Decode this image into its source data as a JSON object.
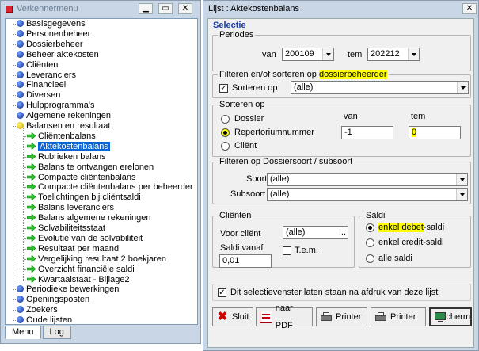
{
  "menu_window": {
    "title": "Verkennermenu",
    "tree": [
      {
        "label": "Basisgegevens",
        "level": 0,
        "kind": "node"
      },
      {
        "label": "Personenbeheer",
        "level": 0,
        "kind": "node"
      },
      {
        "label": "Dossierbeheer",
        "level": 0,
        "kind": "node"
      },
      {
        "label": "Beheer aktekosten",
        "level": 0,
        "kind": "node"
      },
      {
        "label": "Cliënten",
        "level": 0,
        "kind": "node"
      },
      {
        "label": "Leveranciers",
        "level": 0,
        "kind": "node"
      },
      {
        "label": "Financieel",
        "level": 0,
        "kind": "node"
      },
      {
        "label": "Diversen",
        "level": 0,
        "kind": "node"
      },
      {
        "label": "Hulpprogramma's",
        "level": 0,
        "kind": "node"
      },
      {
        "label": "Algemene rekeningen",
        "level": 0,
        "kind": "node"
      },
      {
        "label": "Balansen en resultaat",
        "level": 0,
        "kind": "open"
      },
      {
        "label": "Cliëntenbalans",
        "level": 1,
        "kind": "leaf"
      },
      {
        "label": "Aktekostenbalans",
        "level": 1,
        "kind": "leaf",
        "selected": true
      },
      {
        "label": "Rubrieken balans",
        "level": 1,
        "kind": "leaf"
      },
      {
        "label": "Balans te ontvangen erelonen",
        "level": 1,
        "kind": "leaf"
      },
      {
        "label": "Compacte cliëntenbalans",
        "level": 1,
        "kind": "leaf"
      },
      {
        "label": "Compacte cliëntenbalans per beheerder",
        "level": 1,
        "kind": "leaf"
      },
      {
        "label": "Toelichtingen bij cliëntsaldi",
        "level": 1,
        "kind": "leaf"
      },
      {
        "label": "Balans leveranciers",
        "level": 1,
        "kind": "leaf"
      },
      {
        "label": "Balans algemene rekeningen",
        "level": 1,
        "kind": "leaf"
      },
      {
        "label": "Solvabiliteitsstaat",
        "level": 1,
        "kind": "leaf"
      },
      {
        "label": "Evolutie van de solvabiliteit",
        "level": 1,
        "kind": "leaf"
      },
      {
        "label": "Resultaat per maand",
        "level": 1,
        "kind": "leaf"
      },
      {
        "label": "Vergelijking resultaat 2 boekjaren",
        "level": 1,
        "kind": "leaf"
      },
      {
        "label": "Overzicht financiële saldi",
        "level": 1,
        "kind": "leaf"
      },
      {
        "label": "Kwartaalstaat - Bijlage2",
        "level": 1,
        "kind": "leaf"
      },
      {
        "label": "Periodieke bewerkingen",
        "level": 0,
        "kind": "node"
      },
      {
        "label": "Openingsposten",
        "level": 0,
        "kind": "node"
      },
      {
        "label": "Zoekers",
        "level": 0,
        "kind": "node"
      },
      {
        "label": "Oude lijsten",
        "level": 0,
        "kind": "node"
      }
    ],
    "tabs": [
      "Menu",
      "Log"
    ]
  },
  "list_window": {
    "title": "Lijst : Aktekostenbalans",
    "selectie_label": "Selectie",
    "periodes": {
      "label": "Periodes",
      "van_label": "van",
      "van_value": "200109",
      "tem_label": "tem",
      "tem_value": "202212"
    },
    "filter1": {
      "label_prefix": "Filteren en/of sorteren op ",
      "label_highlight": "dossierbeheerder",
      "check_label": "Sorteren op",
      "combo_value": "(alle)"
    },
    "sorteren": {
      "label": "Sorteren op",
      "van_label": "van",
      "tem_label": "tem",
      "options": [
        "Dossier",
        "Repertoriumnummer",
        "Cliënt"
      ],
      "selected": 1,
      "van_value": "-1",
      "tem_value": "0"
    },
    "filter2": {
      "label": "Filteren op Dossiersoort / subsoort",
      "soort_label": "Soort",
      "soort_value": "(alle)",
      "subsoort_label": "Subsoort",
      "subsoort_value": "(alle)"
    },
    "clienten": {
      "label": "Cliënten",
      "voor_label": "Voor cliënt",
      "voor_value": "(alle)",
      "browse": "...",
      "saldi_label": "Saldi vanaf",
      "saldi_value": "0,01",
      "tem_check": "T.e.m."
    },
    "saldi": {
      "label": "Saldi",
      "options": [
        {
          "prefix": "enkel ",
          "hl": "debet",
          "suffix": "-saldi"
        },
        {
          "prefix": "enkel credit-saldi",
          "hl": "",
          "suffix": ""
        },
        {
          "prefix": "alle saldi",
          "hl": "",
          "suffix": ""
        }
      ],
      "selected": 0
    },
    "keep_open_label": "Dit selectievenster laten staan na afdruk van deze lijst",
    "buttons": {
      "sluit": "Sluit",
      "pdf": "naar PDF",
      "printer1": "Printer",
      "printer2": "Printer",
      "scherm": "Scherm"
    }
  }
}
